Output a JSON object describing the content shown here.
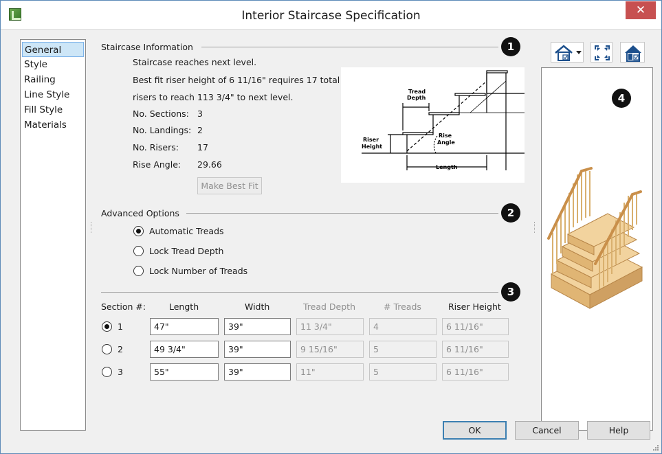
{
  "window": {
    "title": "Interior Staircase Specification",
    "close_glyph": "✕"
  },
  "nav": {
    "items": [
      {
        "label": "General",
        "selected": true
      },
      {
        "label": "Style"
      },
      {
        "label": "Railing"
      },
      {
        "label": "Line Style"
      },
      {
        "label": "Fill Style"
      },
      {
        "label": "Materials"
      }
    ]
  },
  "staircase_info": {
    "heading": "Staircase Information",
    "badge": "1",
    "line1": "Staircase reaches next level.",
    "line2": "Best fit riser height of 6 11/16\" requires 17 total",
    "line3": "risers to reach 113 3/4\" to next level.",
    "rows": [
      {
        "label": "No. Sections:",
        "value": "3"
      },
      {
        "label": "No. Landings:",
        "value": "2"
      },
      {
        "label": "No. Risers:",
        "value": "17"
      },
      {
        "label": "Rise Angle:",
        "value": "29.66"
      }
    ],
    "make_best_fit": "Make Best Fit",
    "diagram": {
      "tread_label_1": "Tread",
      "tread_label_2": "Depth",
      "riser_label_1": "Riser",
      "riser_label_2": "Height",
      "rise_label_1": "Rise",
      "rise_label_2": "Angle",
      "length_label": "Length"
    }
  },
  "advanced": {
    "heading": "Advanced Options",
    "badge": "2",
    "options": [
      {
        "label": "Automatic Treads",
        "checked": true
      },
      {
        "label": "Lock Tread Depth",
        "checked": false
      },
      {
        "label": "Lock Number of Treads",
        "checked": false
      }
    ]
  },
  "sections": {
    "badge": "3",
    "headers": {
      "section": "Section #:",
      "length": "Length",
      "width": "Width",
      "tread_depth": "Tread Depth",
      "treads": "# Treads",
      "riser_height": "Riser Height"
    },
    "rows": [
      {
        "num": "1",
        "selected": true,
        "length": "47\"",
        "width": "39\"",
        "tread_depth": "11 3/4\"",
        "treads": "4",
        "riser_height": "6 11/16\""
      },
      {
        "num": "2",
        "selected": false,
        "length": "49 3/4\"",
        "width": "39\"",
        "tread_depth": "9 15/16\"",
        "treads": "5",
        "riser_height": "6 11/16\""
      },
      {
        "num": "3",
        "selected": false,
        "length": "55\"",
        "width": "39\"",
        "tread_depth": "11\"",
        "treads": "5",
        "riser_height": "6 11/16\""
      }
    ]
  },
  "preview": {
    "badge": "4"
  },
  "footer": {
    "ok": "OK",
    "cancel": "Cancel",
    "help": "Help"
  },
  "colors": {
    "accent": "#3c7fb1",
    "close": "#c75050",
    "wood": "#e8c48a"
  }
}
